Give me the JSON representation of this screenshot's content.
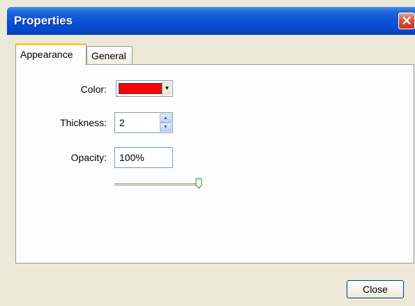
{
  "window": {
    "title": "Properties",
    "close_glyph": "✕"
  },
  "tabs": [
    {
      "label": "Appearance",
      "active": true
    },
    {
      "label": "General",
      "active": false
    }
  ],
  "form": {
    "color_label": "Color:",
    "color_value_hex": "#ff0000",
    "thickness_label": "Thickness:",
    "thickness_value": "2",
    "opacity_label": "Opacity:",
    "opacity_value": "100%",
    "opacity_slider_fraction": 1.0
  },
  "footer": {
    "close_label": "Close"
  },
  "colors": {
    "titlebar": "#0a52d8",
    "selected_color": "#ff0000",
    "active_tab_accent": "#ffc83c"
  },
  "icons": {
    "window_close": "close-icon",
    "combo_arrow": "dropdown-arrow-icon",
    "spin_up": "chevron-up-icon",
    "spin_down": "chevron-down-icon",
    "slider_thumb": "slider-thumb"
  }
}
